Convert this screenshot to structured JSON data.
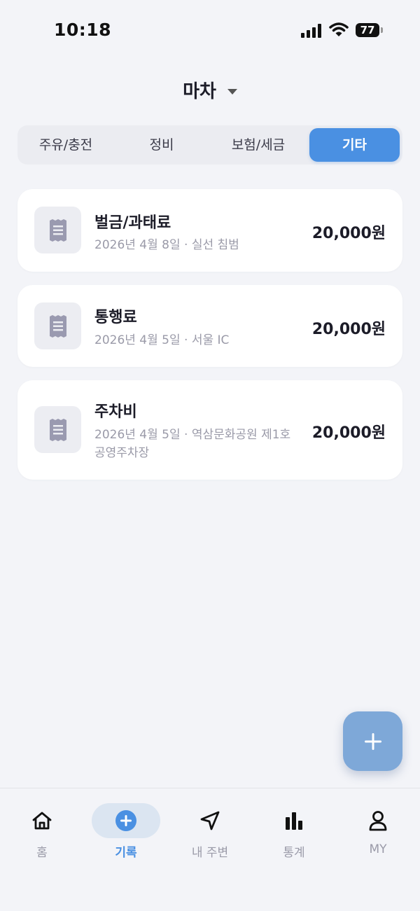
{
  "status_bar": {
    "time": "10:18",
    "battery": "77"
  },
  "header": {
    "vehicle_name": "마차"
  },
  "tabs": [
    {
      "label": "주유/충전",
      "active": false
    },
    {
      "label": "정비",
      "active": false
    },
    {
      "label": "보험/세금",
      "active": false
    },
    {
      "label": "기타",
      "active": true
    }
  ],
  "records": [
    {
      "title": "벌금/과태료",
      "subtitle": "2026년 4월 8일 · 실선 침범",
      "amount": "20,000원",
      "icon": "receipt-icon"
    },
    {
      "title": "통행료",
      "subtitle": "2026년 4월 5일 · 서울 IC",
      "amount": "20,000원",
      "icon": "receipt-icon"
    },
    {
      "title": "주차비",
      "subtitle": "2026년 4월 5일 · 역삼문화공원 제1호 공영주차장",
      "amount": "20,000원",
      "icon": "receipt-icon"
    }
  ],
  "fab": {
    "icon": "plus-icon"
  },
  "bottom_nav": [
    {
      "label": "홈",
      "icon": "home-icon",
      "active": false
    },
    {
      "label": "기록",
      "icon": "add-circle-icon",
      "active": true
    },
    {
      "label": "내 주변",
      "icon": "navigation-arrow-icon",
      "active": false
    },
    {
      "label": "통계",
      "icon": "bar-chart-icon",
      "active": false
    },
    {
      "label": "MY",
      "icon": "person-icon",
      "active": false
    }
  ],
  "colors": {
    "accent": "#4a90e2",
    "fab": "#7ea8d8",
    "background": "#f3f4f8",
    "card": "#ffffff"
  }
}
